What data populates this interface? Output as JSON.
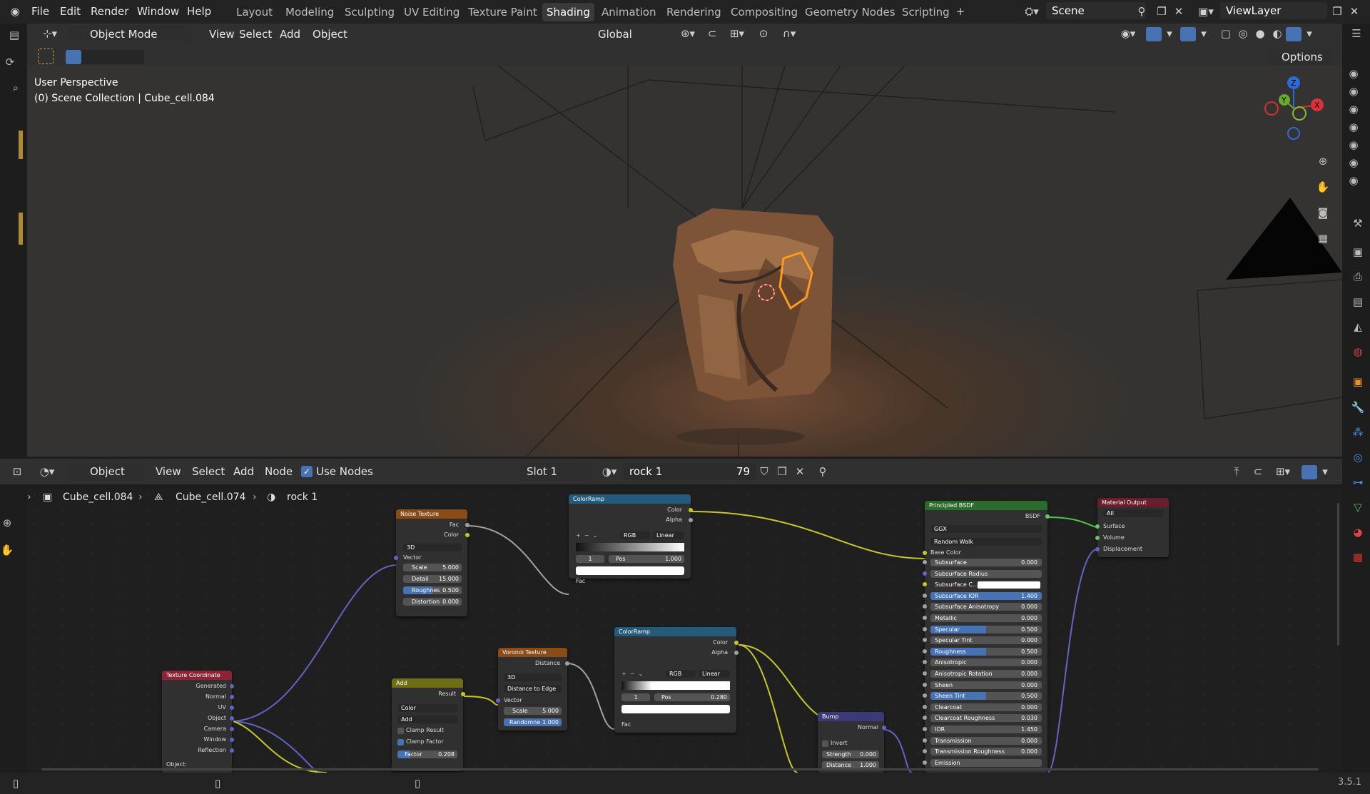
{
  "topbar": {
    "menus": [
      "File",
      "Edit",
      "Render",
      "Window",
      "Help"
    ],
    "workspaces": [
      "Layout",
      "Modeling",
      "Sculpting",
      "UV Editing",
      "Texture Paint",
      "Shading",
      "Animation",
      "Rendering",
      "Compositing",
      "Geometry Nodes",
      "Scripting"
    ],
    "active_workspace": "Shading",
    "scene": "Scene",
    "view_layer": "ViewLayer"
  },
  "viewport_header": {
    "mode": "Object Mode",
    "menus": [
      "View",
      "Select",
      "Add",
      "Object"
    ],
    "transform_orientation": "Global",
    "options": "Options"
  },
  "viewport": {
    "perspective": "User Perspective",
    "collection": "(0) Scene Collection | Cube_cell.084"
  },
  "node_header": {
    "editor_mode": "Object",
    "menus": [
      "View",
      "Select",
      "Add",
      "Node"
    ],
    "use_nodes": "Use Nodes",
    "slot": "Slot 1",
    "material": "rock 1",
    "users": "79"
  },
  "breadcrumb": [
    "Cube_cell.084",
    "Cube_cell.074",
    "rock 1"
  ],
  "nodes": {
    "noise": {
      "title": "Noise Texture",
      "out_fac": "Fac",
      "out_color": "Color",
      "dim": "3D",
      "vector": "Vector",
      "scale_l": "Scale",
      "scale_v": "5.000",
      "detail_l": "Detail",
      "detail_v": "15.000",
      "rough_l": "Roughnes",
      "rough_v": "0.500",
      "dist_l": "Distortion",
      "dist_v": "0.000"
    },
    "ramp1": {
      "title": "ColorRamp",
      "color": "Color",
      "alpha": "Alpha",
      "mode": "RGB",
      "interp": "Linear",
      "idx": "1",
      "pos_l": "Pos",
      "pos_v": "1.000",
      "fac": "Fac"
    },
    "ramp2": {
      "title": "ColorRamp",
      "color": "Color",
      "alpha": "Alpha",
      "mode": "RGB",
      "interp": "Linear",
      "idx": "1",
      "pos_l": "Pos",
      "pos_v": "0.280",
      "fac": "Fac"
    },
    "voronoi": {
      "title": "Voronoi Texture",
      "distance": "Distance",
      "dim": "3D",
      "feature": "Distance to Edge",
      "vector": "Vector",
      "scale_l": "Scale",
      "scale_v": "5.000",
      "rand_l": "Randomne",
      "rand_v": "1.000"
    },
    "texcoord": {
      "title": "Texture Coordinate",
      "outputs": [
        "Generated",
        "Normal",
        "UV",
        "Object",
        "Camera",
        "Window",
        "Reflection"
      ],
      "object": "Object:"
    },
    "add": {
      "title": "Add",
      "result": "Result",
      "type": "Color",
      "op": "Add",
      "clamp_result": "Clamp Result",
      "clamp_factor": "Clamp Factor",
      "factor_l": "Factor",
      "factor_v": "0.208"
    },
    "bump": {
      "title": "Bump",
      "normal": "Normal",
      "invert": "Invert",
      "strength_l": "Strength",
      "strength_v": "0.000",
      "distance_l": "Distance",
      "distance_v": "1.000"
    },
    "bsdf": {
      "title": "Principled BSDF",
      "out": "BSDF",
      "dist": "GGX",
      "sss": "Random Walk",
      "base_color": "Base Color",
      "rows": [
        {
          "l": "Subsurface",
          "v": "0.000"
        },
        {
          "l": "Subsurface Radius",
          "v": ""
        },
        {
          "l": "Subsurface C...",
          "v": ""
        },
        {
          "l": "Subsurface IOR",
          "v": "1.400"
        },
        {
          "l": "Subsurface Anisotropy",
          "v": "0.000"
        },
        {
          "l": "Metallic",
          "v": "0.000"
        },
        {
          "l": "Specular",
          "v": "0.500"
        },
        {
          "l": "Specular Tint",
          "v": "0.000"
        },
        {
          "l": "Roughness",
          "v": "0.500"
        },
        {
          "l": "Anisotropic",
          "v": "0.000"
        },
        {
          "l": "Anisotropic Rotation",
          "v": "0.000"
        },
        {
          "l": "Sheen",
          "v": "0.000"
        },
        {
          "l": "Sheen Tint",
          "v": "0.500"
        },
        {
          "l": "Clearcoat",
          "v": "0.000"
        },
        {
          "l": "Clearcoat Roughness",
          "v": "0.030"
        },
        {
          "l": "IOR",
          "v": "1.450"
        },
        {
          "l": "Transmission",
          "v": "0.000"
        },
        {
          "l": "Transmission Roughness",
          "v": "0.000"
        },
        {
          "l": "Emission",
          "v": ""
        }
      ]
    },
    "output": {
      "title": "Material Output",
      "target": "All",
      "surface": "Surface",
      "volume": "Volume",
      "displacement": "Displacement"
    }
  },
  "status": {
    "version": "3.5.1"
  },
  "colors": {
    "noise_header": "#8a4b17",
    "ramp_header": "#265a7a",
    "texcoord_header": "#8c2436",
    "add_header": "#6e6e14",
    "bsdf_header": "#2b6b2b",
    "output_header": "#6b1d2e",
    "voronoi_header": "#8a4b17",
    "bump_header": "#3a3a7a",
    "accent": "#4772b3"
  }
}
